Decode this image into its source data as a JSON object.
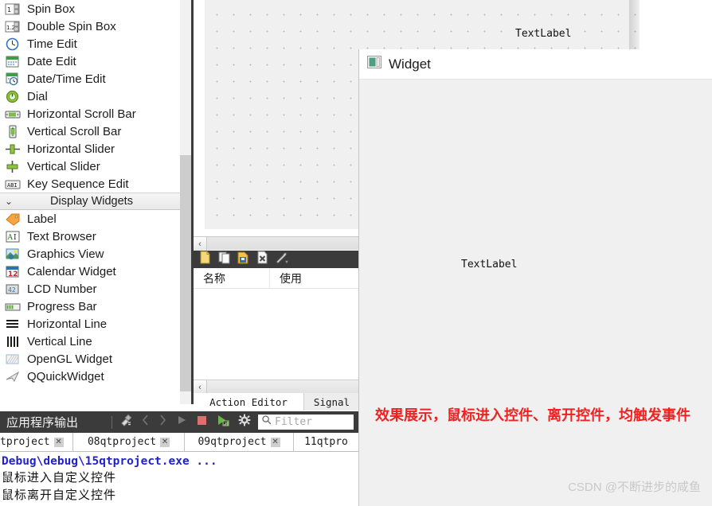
{
  "widget_box": {
    "items": [
      {
        "label": "Spin Box",
        "icon": "spinbox-icon"
      },
      {
        "label": "Double Spin Box",
        "icon": "double-spinbox-icon"
      },
      {
        "label": "Time Edit",
        "icon": "time-edit-icon"
      },
      {
        "label": "Date Edit",
        "icon": "date-edit-icon"
      },
      {
        "label": "Date/Time Edit",
        "icon": "date-time-edit-icon"
      },
      {
        "label": "Dial",
        "icon": "dial-icon"
      },
      {
        "label": "Horizontal Scroll Bar",
        "icon": "horizontal-scrollbar-icon"
      },
      {
        "label": "Vertical Scroll Bar",
        "icon": "vertical-scrollbar-icon"
      },
      {
        "label": "Horizontal Slider",
        "icon": "horizontal-slider-icon"
      },
      {
        "label": "Vertical Slider",
        "icon": "vertical-slider-icon"
      },
      {
        "label": "Key Sequence Edit",
        "icon": "key-sequence-edit-icon"
      }
    ],
    "group_header": {
      "label": "Display Widgets",
      "chevron": "⌄"
    },
    "display_items": [
      {
        "label": "Label",
        "icon": "label-icon"
      },
      {
        "label": "Text Browser",
        "icon": "text-browser-icon"
      },
      {
        "label": "Graphics View",
        "icon": "graphics-view-icon"
      },
      {
        "label": "Calendar Widget",
        "icon": "calendar-widget-icon"
      },
      {
        "label": "LCD Number",
        "icon": "lcd-number-icon"
      },
      {
        "label": "Progress Bar",
        "icon": "progress-bar-icon"
      },
      {
        "label": "Horizontal Line",
        "icon": "horizontal-line-icon"
      },
      {
        "label": "Vertical Line",
        "icon": "vertical-line-icon"
      },
      {
        "label": "OpenGL Widget",
        "icon": "opengl-widget-icon"
      },
      {
        "label": "QQuickWidget",
        "icon": "qquickwidget-icon"
      }
    ],
    "scroll_down_arrow": "⌄"
  },
  "designer": {
    "form_label": "TextLabel"
  },
  "action_panel": {
    "scroll_left_arrow": "‹",
    "toolbar_icons": [
      "new-action-icon",
      "copy-action-icon",
      "edit-action-icon",
      "delete-action-icon",
      "configure-icon"
    ],
    "columns": [
      "名称",
      "使用"
    ],
    "tabs": [
      {
        "label": "Action Editor",
        "active": true
      },
      {
        "label": "Signal",
        "active": false
      }
    ]
  },
  "widget_window": {
    "title": "Widget",
    "icon": "qt-widget-icon",
    "text_label": "TextLabel",
    "red_note": "效果展示，鼠标进入控件、离开控件，均触发事件",
    "watermark": "CSDN @不断进步的咸鱼",
    "red_color": "#ee2222"
  },
  "output_pane": {
    "title": "应用程序输出",
    "toolbar_icons": [
      "clear-icon",
      "prev-icon",
      "next-icon",
      "run-icon",
      "stop-icon",
      "attach-debugger-icon",
      "settings-icon"
    ],
    "filter_placeholder": "Filter",
    "filter_value": "",
    "filter_icon": "search-icon",
    "tabs": [
      {
        "label": "tproject",
        "close": "✕"
      },
      {
        "label": "08qtproject",
        "close": "✕"
      },
      {
        "label": "09qtproject",
        "close": "✕"
      },
      {
        "label": "11qtpro",
        "close": ""
      }
    ],
    "lines": [
      "Debug\\debug\\15qtproject.exe ...",
      "鼠标进入自定义控件",
      "鼠标离开自定义控件"
    ]
  }
}
